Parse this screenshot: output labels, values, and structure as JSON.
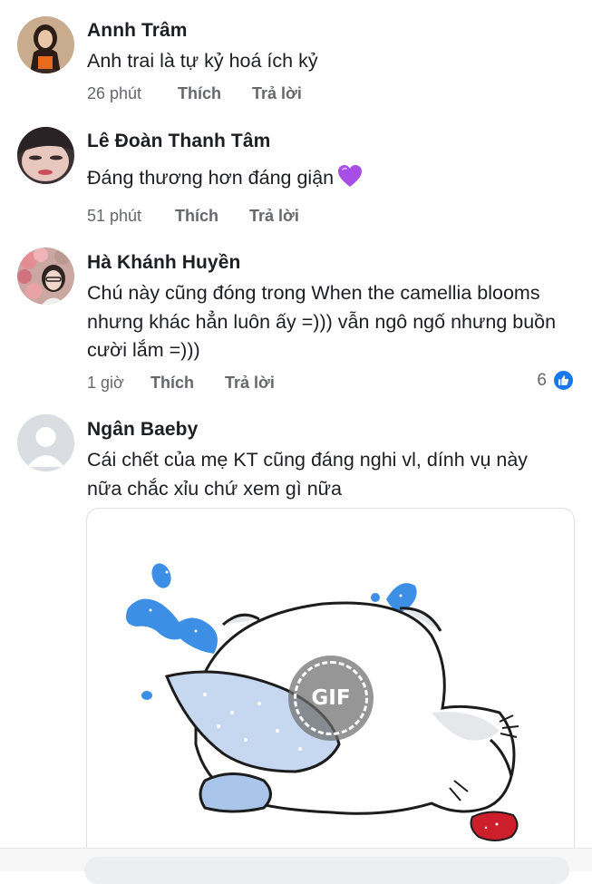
{
  "comments": [
    {
      "name": "Annh Trâm",
      "text": "Anh trai là tự kỷ hoá ích kỷ",
      "time": "26 phút",
      "like_label": "Thích",
      "reply_label": "Trả lời",
      "avatar_icon": "profile-photo"
    },
    {
      "name": "Lê Đoàn Thanh Tâm",
      "text": "Đáng thương hơn đáng giận",
      "emoji": "purple-heart",
      "time": "51 phút",
      "like_label": "Thích",
      "reply_label": "Trả lời",
      "avatar_icon": "profile-photo"
    },
    {
      "name": "Hà Khánh Huyền",
      "text": "Chú này cũng đóng trong When the camellia blooms nhưng khác hẳn luôn ấy =))) vẫn ngô ngố nhưng buồn cười lắm =)))",
      "time": "1 giờ",
      "like_label": "Thích",
      "reply_label": "Trả lời",
      "reaction_count": "6",
      "reaction_icon": "like-icon",
      "avatar_icon": "profile-photo"
    },
    {
      "name": "Ngân Baeby",
      "text": "Cái chết của mẹ KT cũng đáng nghi vl, dính vụ này nữa chắc xỉu chứ xem gì nữa",
      "avatar_icon": "default-avatar",
      "attachment": {
        "type": "gif",
        "badge_label": "GIF"
      }
    }
  ],
  "colors": {
    "text": "#1c1e21",
    "meta": "#65676b",
    "like_blue": "#1877f2",
    "heart_purple": "#a64ee6",
    "splash_blue": "#3d8fe6"
  }
}
